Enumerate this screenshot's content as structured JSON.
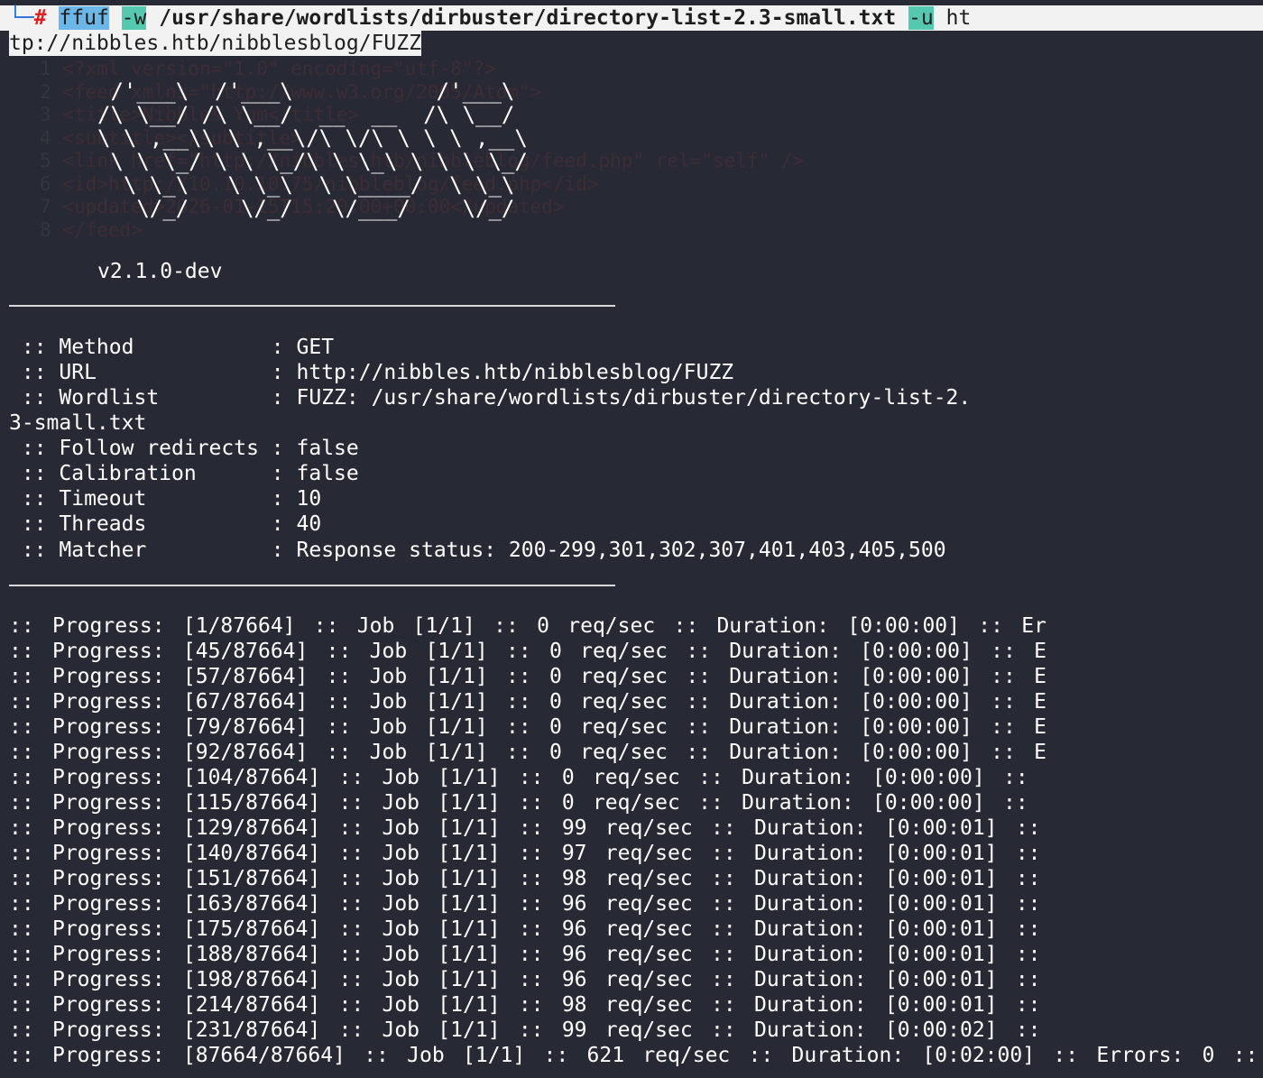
{
  "command": {
    "prompt_corner": "└─",
    "prompt_hash": "#",
    "tool": "ffuf",
    "flag_w": "-w",
    "wordlist_path": "/usr/share/wordlists/dirbuster/directory-list-2.3-small.txt",
    "flag_u": "-u",
    "url_part1": "ht",
    "url_part2": "tp://nibbles.htb/nibblesblog/FUZZ"
  },
  "background_file": {
    "lines": [
      {
        "num": "1",
        "text": "<?xml version=\"1.0\" encoding=\"utf-8\"?>"
      },
      {
        "num": "2",
        "text": "<feed xmlns=\"http://www.w3.org/2005/Atom\">"
      },
      {
        "num": "3",
        "text": "<title>Nibbles Yum</title>"
      },
      {
        "num": "4",
        "text": "<subtitle></subtitle>"
      },
      {
        "num": "5",
        "text": "<link href=\"http://nibbles.htb/nibbleblog/feed.php\" rel=\"self\" />"
      },
      {
        "num": "6",
        "text": "<id>http://10.10.10.75/nibbleblog/feed.php</id>"
      },
      {
        "num": "7",
        "text": "<updated>2026-01-15T15:20:00+00:00</updated>"
      },
      {
        "num": "8",
        "text": "</feed>"
      }
    ]
  },
  "banner": {
    "art": [
      "       /'___\\  /'___\\           /'___\\",
      "      /\\ \\__/ /\\ \\__/  __  __  /\\ \\__/",
      "      \\ \\ ,__\\\\ \\ ,__\\/\\ \\/\\ \\ \\ \\ ,__\\",
      "       \\ \\ \\_/ \\ \\ \\_/\\ \\ \\_\\ \\ \\ \\ \\_/",
      "        \\ \\_\\   \\ \\_\\  \\ \\____/  \\ \\_\\",
      "         \\/_/    \\/_/   \\/___/    \\/_/"
    ],
    "version": "v2.1.0-dev"
  },
  "config": {
    "method_label": " :: Method           : ",
    "method_value": "GET",
    "url_label": " :: URL              : ",
    "url_value": "http://nibbles.htb/nibblesblog/FUZZ",
    "wordlist_label": " :: Wordlist         : ",
    "wordlist_value": "FUZZ: /usr/share/wordlists/dirbuster/directory-list-2.",
    "wordlist_wrap": "3-small.txt",
    "follow_label": " :: Follow redirects : ",
    "follow_value": "false",
    "calibration_label": " :: Calibration      : ",
    "calibration_value": "false",
    "timeout_label": " :: Timeout          : ",
    "timeout_value": "10",
    "threads_label": " :: Threads          : ",
    "threads_value": "40",
    "matcher_label": " :: Matcher          : ",
    "matcher_value": "Response status: 200-299,301,302,307,401,403,405,500"
  },
  "progress_lines": [
    ":: Progress: [1/87664] :: Job [1/1] :: 0 req/sec :: Duration: [0:00:00] :: Er",
    ":: Progress: [45/87664] :: Job [1/1] :: 0 req/sec :: Duration: [0:00:00] :: E",
    ":: Progress: [57/87664] :: Job [1/1] :: 0 req/sec :: Duration: [0:00:00] :: E",
    ":: Progress: [67/87664] :: Job [1/1] :: 0 req/sec :: Duration: [0:00:00] :: E",
    ":: Progress: [79/87664] :: Job [1/1] :: 0 req/sec :: Duration: [0:00:00] :: E",
    ":: Progress: [92/87664] :: Job [1/1] :: 0 req/sec :: Duration: [0:00:00] :: E",
    ":: Progress: [104/87664] :: Job [1/1] :: 0 req/sec :: Duration: [0:00:00] ::",
    ":: Progress: [115/87664] :: Job [1/1] :: 0 req/sec :: Duration: [0:00:00] ::",
    ":: Progress: [129/87664] :: Job [1/1] :: 99 req/sec :: Duration: [0:00:01] ::",
    ":: Progress: [140/87664] :: Job [1/1] :: 97 req/sec :: Duration: [0:00:01] ::",
    ":: Progress: [151/87664] :: Job [1/1] :: 98 req/sec :: Duration: [0:00:01] ::",
    ":: Progress: [163/87664] :: Job [1/1] :: 96 req/sec :: Duration: [0:00:01] ::",
    ":: Progress: [175/87664] :: Job [1/1] :: 96 req/sec :: Duration: [0:00:01] ::",
    ":: Progress: [188/87664] :: Job [1/1] :: 96 req/sec :: Duration: [0:00:01] ::",
    ":: Progress: [198/87664] :: Job [1/1] :: 96 req/sec :: Duration: [0:00:01] ::",
    ":: Progress: [214/87664] :: Job [1/1] :: 98 req/sec :: Duration: [0:00:01] ::",
    ":: Progress: [231/87664] :: Job [1/1] :: 99 req/sec :: Duration: [0:00:02] ::",
    ":: Progress: [87664/87664] :: Job [1/1] :: 621 req/sec :: Duration: [0:02:00] :: Errors: 0 ::"
  ],
  "colors": {
    "background": "#272a34",
    "text": "#ffffff",
    "cmd_bar": "#f2f2f2",
    "tool_highlight": "#6cb6e8",
    "flag_highlight": "#55c9b0",
    "prompt_hash": "#e02020"
  }
}
